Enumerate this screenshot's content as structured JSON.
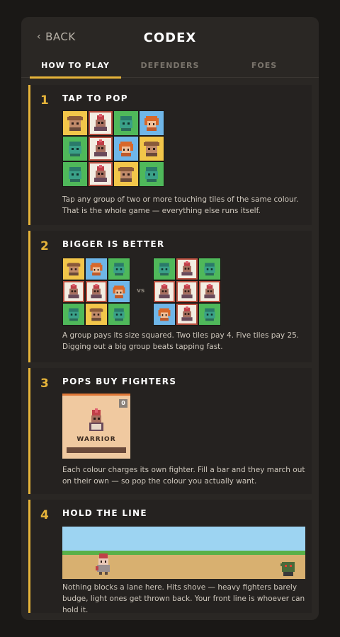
{
  "header": {
    "back_label": "BACK",
    "title": "CODEX"
  },
  "tabs": [
    {
      "label": "HOW TO PLAY",
      "active": true
    },
    {
      "label": "DEFENDERS",
      "active": false
    },
    {
      "label": "FOES",
      "active": false
    }
  ],
  "steps": [
    {
      "number": "1",
      "title": "TAP TO POP",
      "text": "Tap any group of two or more touching tiles of the same colour. That is the whole game — everything else runs itself.",
      "grid": [
        [
          "yellow",
          "white",
          "green",
          "blue"
        ],
        [
          "green",
          "white",
          "blue",
          "yellow"
        ],
        [
          "green",
          "white",
          "yellow",
          "green"
        ]
      ]
    },
    {
      "number": "2",
      "title": "BIGGER IS BETTER",
      "text": "A group pays its size squared. Two tiles pay 4. Five tiles pay 25. Digging out a big group beats tapping fast.",
      "vs_label": "vs",
      "grid_left": [
        [
          "yellow",
          "blue",
          "green"
        ],
        [
          "white",
          "white",
          "blue"
        ],
        [
          "green",
          "yellow",
          "green"
        ]
      ],
      "grid_right": [
        [
          "green",
          "white",
          "green"
        ],
        [
          "white",
          "white",
          "white"
        ],
        [
          "blue",
          "white",
          "green"
        ]
      ]
    },
    {
      "number": "3",
      "title": "POPS BUY FIGHTERS",
      "text": "Each colour charges its own fighter. Fill a bar and they march out on their own — so pop the colour you actually want.",
      "fighter": {
        "name": "WARRIOR",
        "badge": "0",
        "charge": 0.0
      }
    },
    {
      "number": "4",
      "title": "HOLD THE LINE",
      "text": "Nothing blocks a lane here. Hits shove — heavy fighters barely budge, light ones get thrown back. Your front line is whoever can hold it."
    }
  ],
  "colors": {
    "accent": "#e6b43a",
    "tile_yellow": "#f2c64a",
    "tile_green": "#4fb85a",
    "tile_blue": "#6fb6e8",
    "tile_white": "#f3ede2"
  }
}
